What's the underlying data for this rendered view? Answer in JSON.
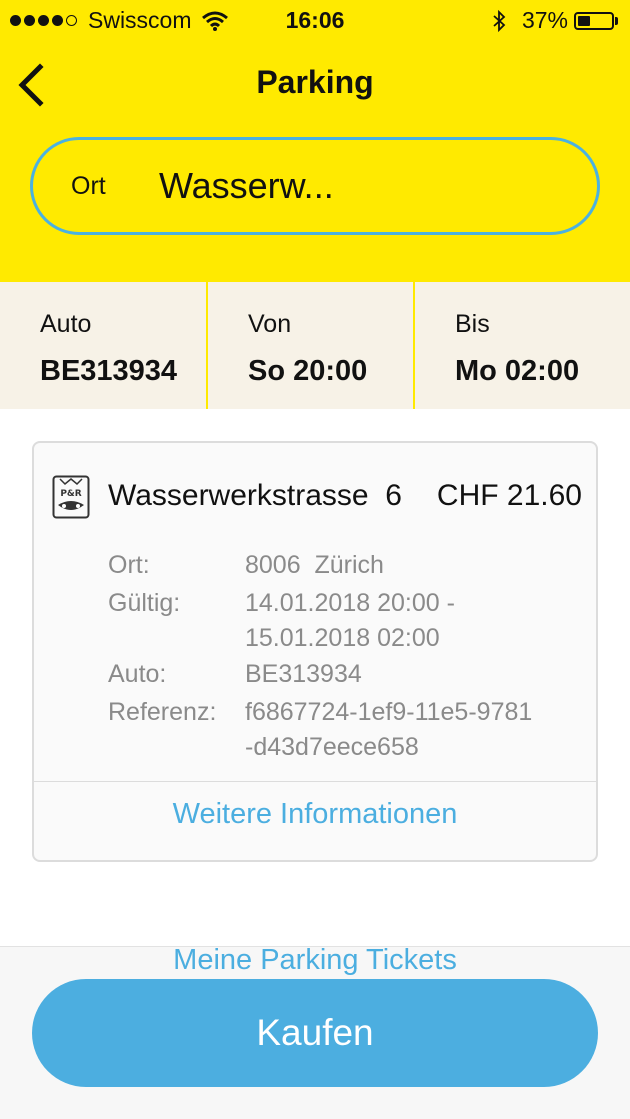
{
  "status_bar": {
    "carrier": "Swisscom",
    "time": "16:06",
    "battery_percent": "37%",
    "battery_level": 0.37,
    "signal_icon": "signal-dots-icon",
    "wifi_icon": "wifi-icon",
    "bluetooth_icon": "bluetooth-icon",
    "battery_icon": "battery-icon"
  },
  "nav": {
    "title": "Parking",
    "back_icon": "chevron-left-icon"
  },
  "location": {
    "label": "Ort",
    "value": "Wasserw..."
  },
  "info": {
    "auto_label": "Auto",
    "auto_value": "BE313934",
    "from_label": "Von",
    "from_value": "So 20:00",
    "to_label": "Bis",
    "to_value": "Mo 02:00"
  },
  "card": {
    "icon": "park-and-ride-icon",
    "icon_text": "P&R",
    "street": "Wasserwerkstrasse  6",
    "price": "CHF 21.60",
    "details": {
      "ort_label": "Ort:",
      "ort_value": "8006  Zürich",
      "valid_label": "Gültig:",
      "valid_line1": "14.01.2018 20:00 -",
      "valid_line2": "15.01.2018 02:00",
      "auto_label": "Auto:",
      "auto_value": "BE313934",
      "ref_label": "Referenz:",
      "ref_line1": "f6867724-1ef9-11e5-9781",
      "ref_line2": "-d43d7eece658"
    },
    "more_link": "Weitere Informationen"
  },
  "footer": {
    "tickets_link": "Meine Parking Tickets",
    "buy_button": "Kaufen"
  },
  "colors": {
    "header_yellow": "#ffea00",
    "accent_blue": "#4caee0",
    "info_strip": "#f7f2e7",
    "muted_text": "#8a8a8a"
  }
}
